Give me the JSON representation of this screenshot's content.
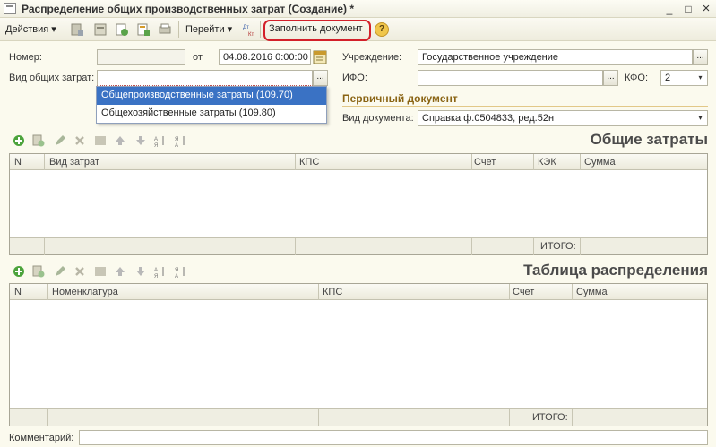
{
  "window": {
    "title": "Распределение общих производственных затрат (Создание) *",
    "minimize": "_",
    "maximize": "□",
    "close": "×"
  },
  "toolbar": {
    "actions_label": "Действия",
    "goto_label": "Перейти",
    "fill_label": "Заполнить документ",
    "dropdown_arrow": "▾",
    "help_glyph": "?"
  },
  "form": {
    "number_label": "Номер:",
    "number_value": "",
    "from_label": "от",
    "date_value": "04.08.2016  0:00:00",
    "cost_type_label": "Вид общих затрат:",
    "cost_type_value": "",
    "institution_label": "Учреждение:",
    "institution_value": "Государственное учреждение",
    "ifo_label": "ИФО:",
    "ifo_value": "",
    "kfo_label": "КФО:",
    "kfo_value": "2",
    "primary_doc_title": "Первичный документ",
    "doc_type_label": "Вид документа:",
    "doc_type_value": "Справка ф.0504833, ред.52н",
    "dots": "..."
  },
  "dropdown": {
    "options": [
      "Общепроизводственные затраты (109.70)",
      "Общехозяйственные затраты (109.80)"
    ]
  },
  "table1": {
    "caption": "Общие затраты",
    "columns": [
      "N",
      "Вид затрат",
      "КПС",
      "Счет",
      "КЭК",
      "Сумма"
    ],
    "total_label": "ИТОГО:"
  },
  "table2": {
    "caption": "Таблица распределения",
    "columns": [
      "N",
      "Номенклатура",
      "КПС",
      "Счет",
      "Сумма"
    ],
    "total_label": "ИТОГО:"
  },
  "comment": {
    "label": "Комментарий:",
    "value": ""
  },
  "colors": {
    "highlight": "#d3202a",
    "section": "#8a6414",
    "selection": "#3a72c4"
  }
}
